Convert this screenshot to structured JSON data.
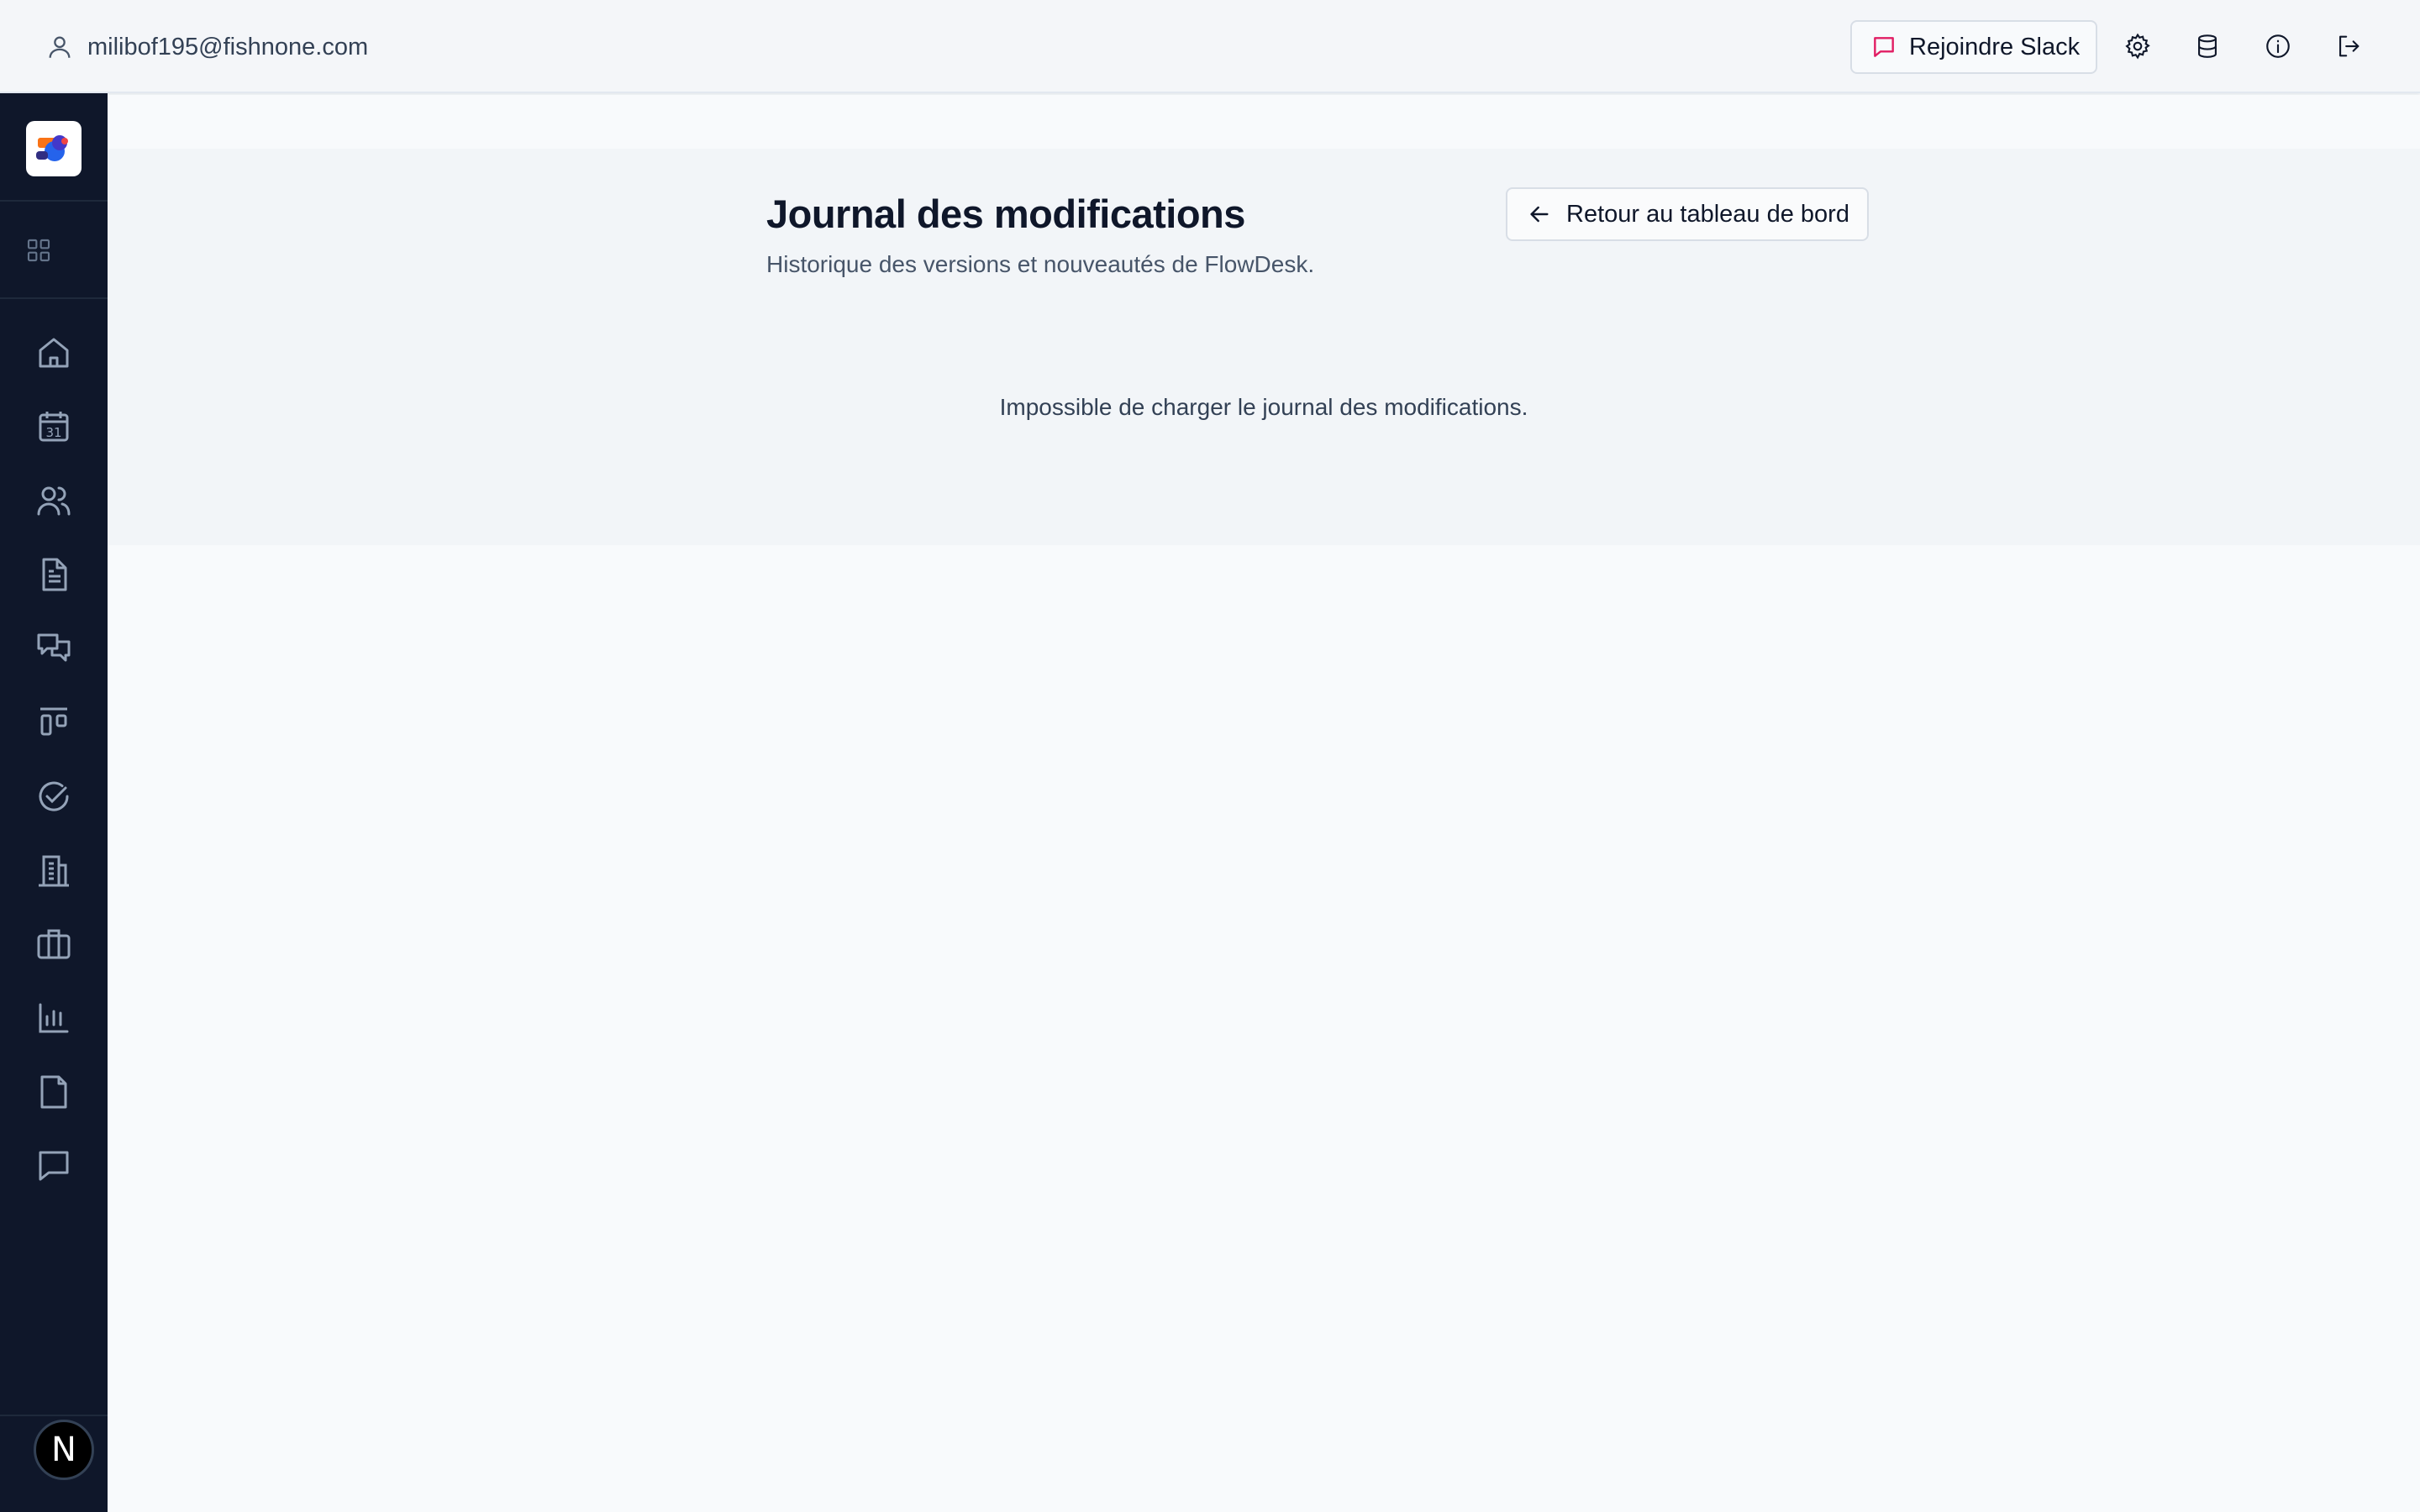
{
  "header": {
    "user_email": "milibof195@fishnone.com",
    "slack_label": "Rejoindre Slack",
    "icons": [
      "user-icon",
      "chat-icon",
      "gear-icon",
      "database-icon",
      "info-icon",
      "logout-icon"
    ]
  },
  "sidebar": {
    "items": [
      {
        "icon": "home-icon"
      },
      {
        "icon": "calendar-icon",
        "text": "31"
      },
      {
        "icon": "users-icon"
      },
      {
        "icon": "document-icon"
      },
      {
        "icon": "messages-icon"
      },
      {
        "icon": "kanban-icon"
      },
      {
        "icon": "check-circle-icon"
      },
      {
        "icon": "building-icon"
      },
      {
        "icon": "briefcase-icon"
      },
      {
        "icon": "bar-chart-icon"
      },
      {
        "icon": "file-icon"
      },
      {
        "icon": "comment-icon"
      }
    ],
    "avatar_letter": "N"
  },
  "page": {
    "title": "Journal des modifications",
    "subtitle": "Historique des versions et nouveautés de FlowDesk.",
    "back_label": "Retour au tableau de bord",
    "error": "Impossible de charger le journal des modifications."
  },
  "colors": {
    "sidebar_bg": "#0f172a",
    "slack_accent": "#e11d63",
    "text_primary": "#0f172a",
    "text_muted": "#475569"
  }
}
